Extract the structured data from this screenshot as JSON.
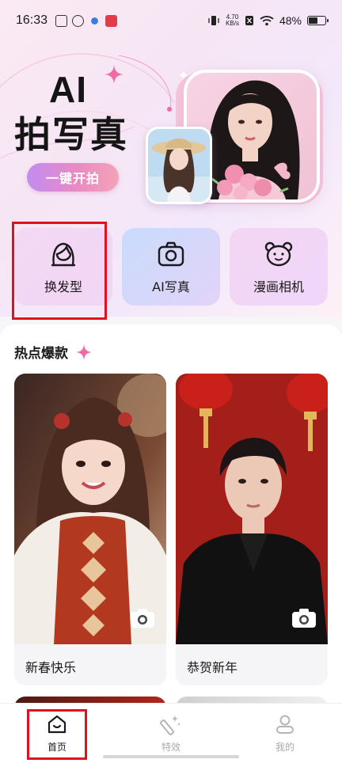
{
  "status_bar": {
    "time": "16:33",
    "net_speed_value": "4.70",
    "net_speed_unit": "KB/s",
    "battery": "48%",
    "battery_level": 0.48
  },
  "hero": {
    "title_line1": "AI",
    "title_line2": "拍写真",
    "cta_label": "一键开拍"
  },
  "functions": [
    {
      "label": "换发型",
      "icon": "hairstyle-icon"
    },
    {
      "label": "AI写真",
      "icon": "camera-icon"
    },
    {
      "label": "漫画相机",
      "icon": "bear-icon"
    }
  ],
  "hot_section": {
    "title": "热点爆款",
    "cards": [
      {
        "label": "新春快乐",
        "icon": "camera-icon"
      },
      {
        "label": "恭贺新年",
        "icon": "camera-icon"
      }
    ]
  },
  "bottom_nav": [
    {
      "label": "首页",
      "icon": "home-icon",
      "active": true
    },
    {
      "label": "特效",
      "icon": "magic-wand-icon",
      "active": false
    },
    {
      "label": "我的",
      "icon": "profile-icon",
      "active": false
    }
  ],
  "colors": {
    "highlight_box": "#e0111e",
    "cta_gradient_start": "#c28df0",
    "cta_gradient_end": "#f4a3b8"
  }
}
